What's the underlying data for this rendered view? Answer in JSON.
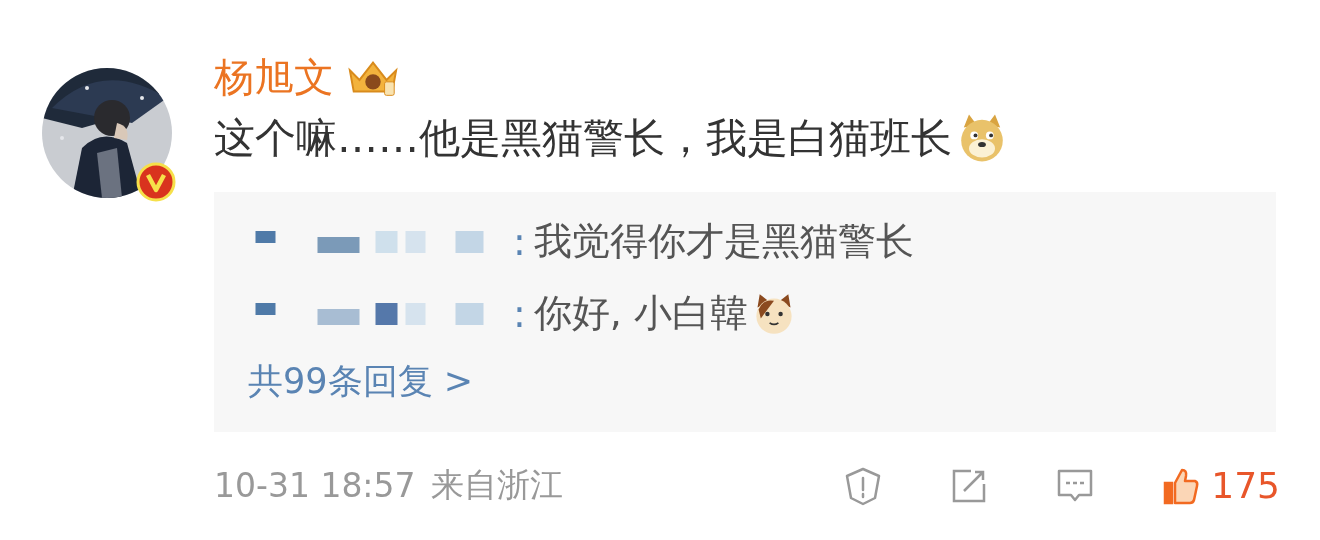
{
  "comment": {
    "author": "杨旭文",
    "text": "这个嘛……他是黑猫警长，我是白猫班长",
    "emoji_after_text": true
  },
  "replies": [
    {
      "prefix": ":",
      "text": "我觉得你才是黑猫警长",
      "emoji": false
    },
    {
      "prefix": ":",
      "text": "你好, 小白韓",
      "emoji": true
    }
  ],
  "more_replies": "共99条回复 >",
  "footer": {
    "time": "10-31 18:57",
    "location": "来自浙江",
    "likes": "175",
    "liked": true
  }
}
